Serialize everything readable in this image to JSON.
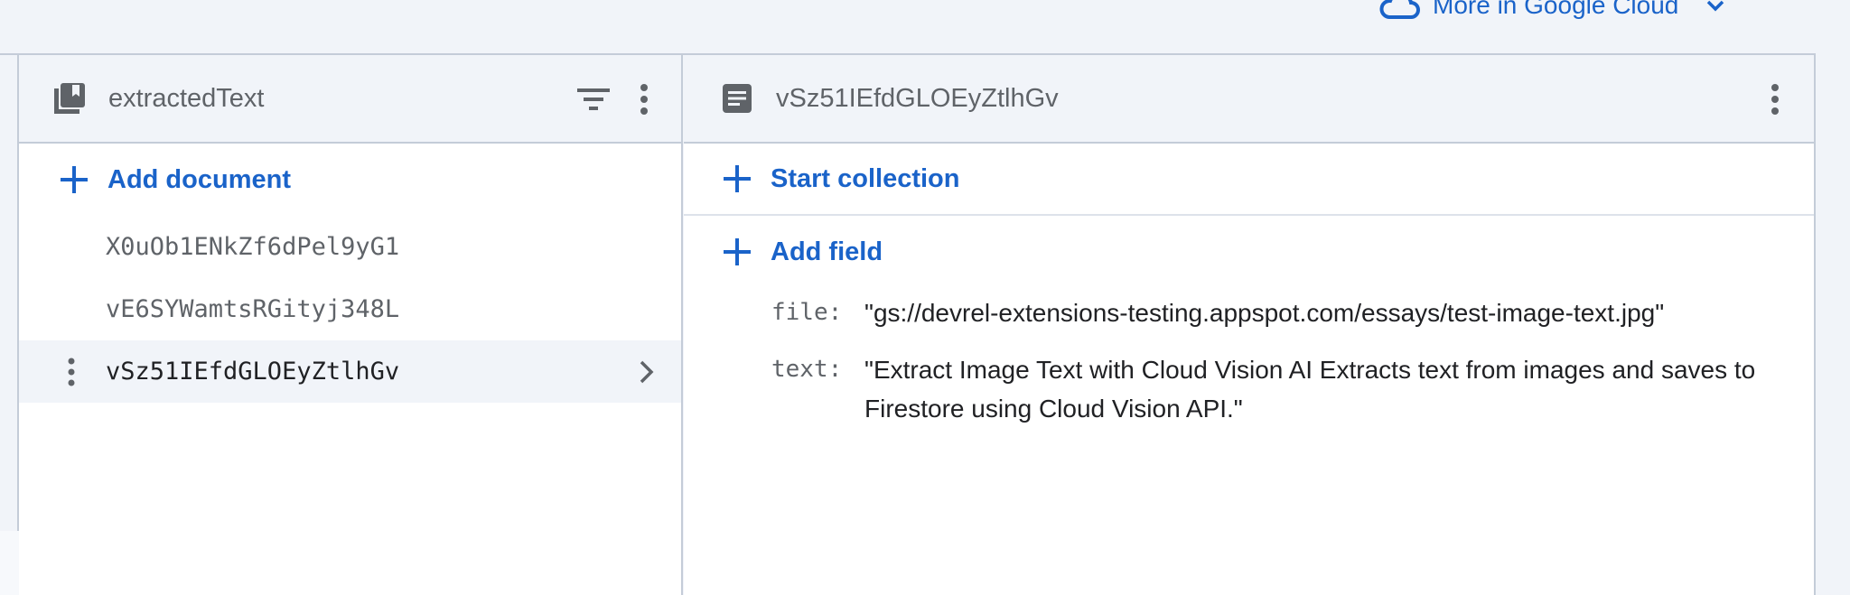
{
  "topbar": {
    "more_link_label": "More in Google Cloud",
    "cloud_icon": "cloud-icon",
    "chevron_icon": "chevron-down-icon"
  },
  "collection_panel": {
    "title": "extractedText",
    "icon": "collection-icon",
    "filter_icon": "filter-icon",
    "menu_icon": "more-vert-icon",
    "add_label": "Add document",
    "documents": [
      {
        "id": "X0uOb1ENkZf6dPel9yG1",
        "selected": false
      },
      {
        "id": "vE6SYWamtsRGityj348L",
        "selected": false
      },
      {
        "id": "vSz51IEfdGLOEyZtlhGv",
        "selected": true
      }
    ]
  },
  "document_panel": {
    "title": "vSz51IEfdGLOEyZtlhGv",
    "icon": "document-icon",
    "menu_icon": "more-vert-icon",
    "start_collection_label": "Start collection",
    "add_field_label": "Add field",
    "fields": [
      {
        "key": "file:",
        "value": "\"gs://devrel-extensions-testing.appspot.com/essays/test-image-text.jpg\""
      },
      {
        "key": "text:",
        "value": "\"Extract Image Text with Cloud Vision AI Extracts text from images and saves to Firestore using Cloud Vision API.\""
      }
    ]
  },
  "colors": {
    "accent": "#1a63c9",
    "header_bg": "#f1f4f9",
    "border": "#c4ccd8",
    "panel_bg": "#ffffff"
  }
}
